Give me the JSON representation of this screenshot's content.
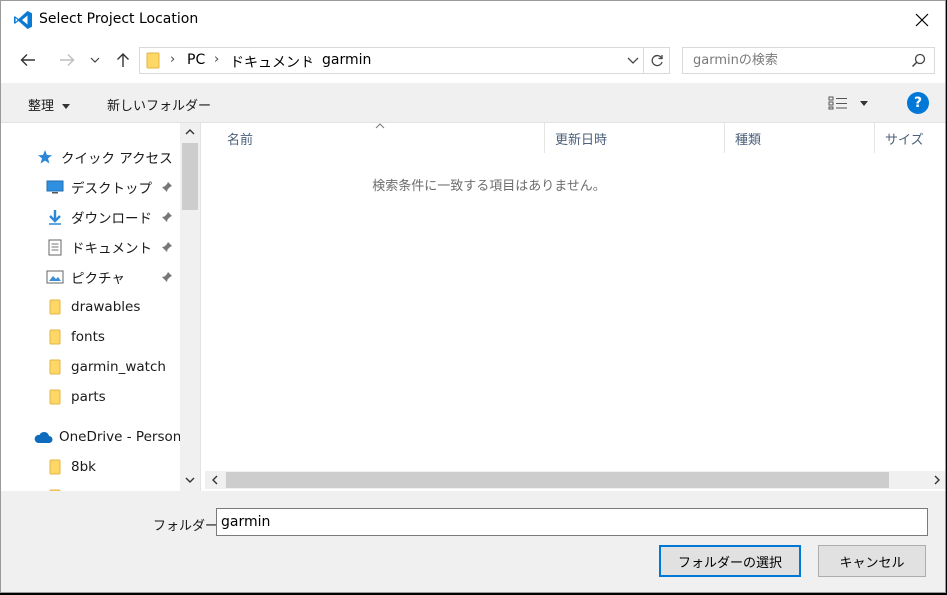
{
  "window": {
    "title": "Select Project Location"
  },
  "nav": {
    "breadcrumbs": [
      "PC",
      "ドキュメント",
      "garmin"
    ],
    "search_placeholder": "garminの検索"
  },
  "commands": {
    "organize": "整理",
    "new_folder": "新しいフォルダー",
    "help": "?"
  },
  "sidebar": {
    "quick_access": "クイック アクセス",
    "items": [
      {
        "label": "デスクトップ",
        "icon": "desktop-icon",
        "pinned": true
      },
      {
        "label": "ダウンロード",
        "icon": "download-icon",
        "pinned": true
      },
      {
        "label": "ドキュメント",
        "icon": "document-icon",
        "pinned": true
      },
      {
        "label": "ピクチャ",
        "icon": "picture-icon",
        "pinned": true
      },
      {
        "label": "drawables",
        "icon": "folder-icon",
        "pinned": false
      },
      {
        "label": "fonts",
        "icon": "folder-icon",
        "pinned": false
      },
      {
        "label": "garmin_watch",
        "icon": "folder-icon",
        "pinned": false
      },
      {
        "label": "parts",
        "icon": "folder-icon",
        "pinned": false
      }
    ],
    "onedrive": "OneDrive - Person",
    "onedrive_items": [
      {
        "label": "8bk",
        "icon": "folder-icon"
      }
    ]
  },
  "main": {
    "columns": [
      "名前",
      "更新日時",
      "種類",
      "サイズ"
    ],
    "empty_message": "検索条件に一致する項目はありません。"
  },
  "footer": {
    "folder_label": "フォルダー:",
    "folder_value": "garmin",
    "select_button": "フォルダーの選択",
    "cancel_button": "キャンセル"
  },
  "colors": {
    "accent": "#0078d7",
    "folder": "#ffd766",
    "onedrive": "#0f6cbd"
  }
}
